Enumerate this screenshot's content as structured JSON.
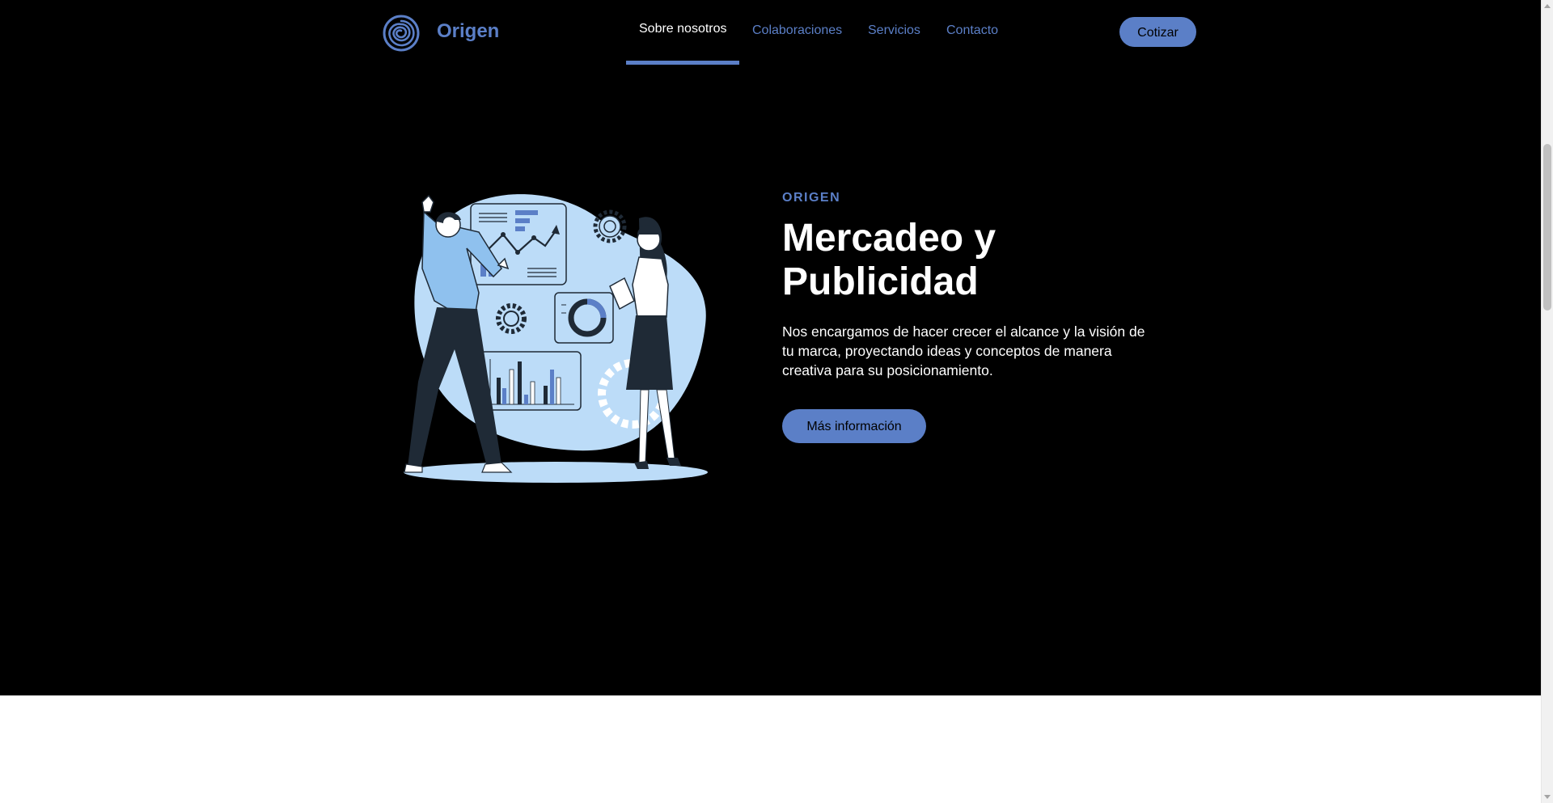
{
  "header": {
    "brand": "Origen",
    "nav": [
      {
        "label": "Sobre nosotros",
        "active": true
      },
      {
        "label": "Colaboraciones",
        "active": false
      },
      {
        "label": "Servicios",
        "active": false
      },
      {
        "label": "Contacto",
        "active": false
      }
    ],
    "cta": "Cotizar"
  },
  "hero": {
    "eyebrow": "ORIGEN",
    "title": "Mercadeo y Publicidad",
    "description": "Nos encargamos de hacer crecer el alcance y la visión de tu marca, proyectando ideas y conceptos de manera creativa para su posicionamiento.",
    "cta": "Más información",
    "illustration": "marketing-team-illustration"
  },
  "colors": {
    "accent": "#5b7fc7",
    "background": "#000000",
    "text": "#ffffff",
    "illustration_fill": "#bcdcf8"
  },
  "icons": {
    "logo": "spiral-logo-icon"
  }
}
